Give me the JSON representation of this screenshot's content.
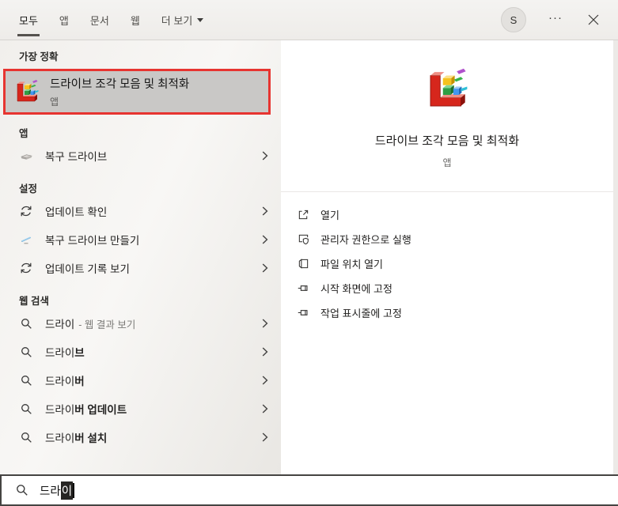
{
  "tabs": {
    "items": [
      {
        "label": "모두"
      },
      {
        "label": "앱"
      },
      {
        "label": "문서"
      },
      {
        "label": "웹"
      },
      {
        "label": "더 보기"
      }
    ]
  },
  "account": {
    "initial": "S"
  },
  "header_icons": {
    "more_options": "···"
  },
  "left": {
    "best_match_header": "가장 정확",
    "best_match": {
      "title": "드라이브 조각 모음 및 최적화",
      "type": "앱"
    },
    "apps_header": "앱",
    "apps": [
      {
        "label": "복구 드라이브"
      }
    ],
    "settings_header": "설정",
    "settings": [
      {
        "label": "업데이트 확인"
      },
      {
        "label": "복구 드라이브 만들기"
      },
      {
        "label": "업데이트 기록 보기"
      }
    ],
    "web_header": "웹 검색",
    "web": [
      {
        "typed": "드라이",
        "suffix": "- 웹 결과 보기"
      },
      {
        "typed": "드라이",
        "completion": "브"
      },
      {
        "typed": "드라이",
        "completion": "버"
      },
      {
        "typed": "드라이",
        "completion": "버 업데이트"
      },
      {
        "typed": "드라이",
        "completion": "버 설치"
      }
    ]
  },
  "right": {
    "app_title": "드라이브 조각 모음 및 최적화",
    "app_type": "앱",
    "actions": [
      {
        "label": "열기"
      },
      {
        "label": "관리자 권한으로 실행"
      },
      {
        "label": "파일 위치 열기"
      },
      {
        "label": "시작 화면에 고정"
      },
      {
        "label": "작업 표시줄에 고정"
      }
    ]
  },
  "search": {
    "typed": "드라",
    "composing": "이"
  },
  "colors": {
    "annotation_red": "#e73430",
    "selection_gray": "#c9c8c6"
  }
}
